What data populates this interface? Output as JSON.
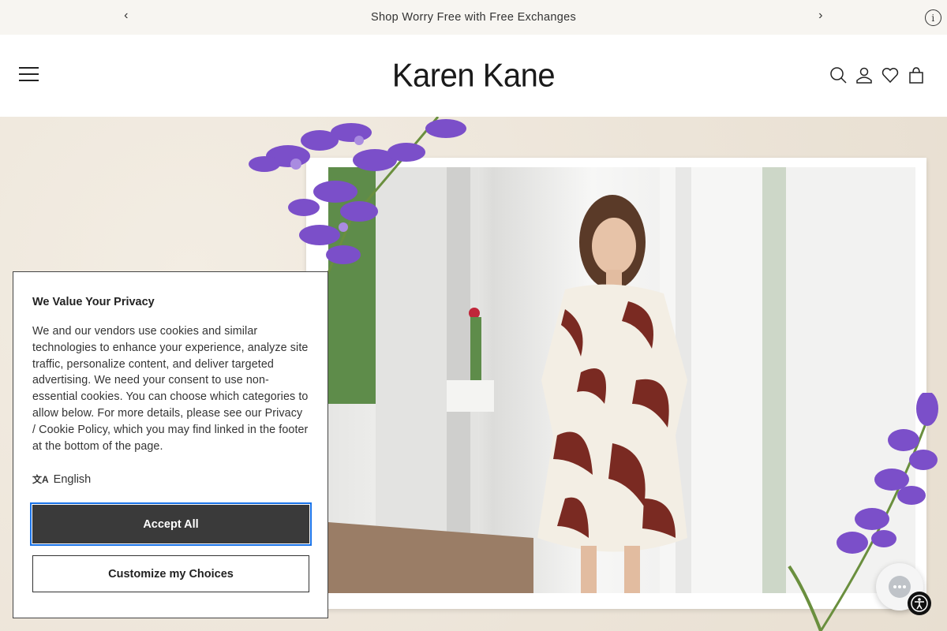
{
  "announcement": {
    "text": "Shop Worry Free with Free Exchanges",
    "prev_label": "‹",
    "next_label": "›",
    "info_label": "i"
  },
  "header": {
    "logo": "Karen Kane",
    "icons": [
      "search-icon",
      "account-icon",
      "wishlist-icon",
      "bag-icon"
    ]
  },
  "cookie_banner": {
    "title": "We Value Your Privacy",
    "body": "We and our vendors use cookies and similar technologies to enhance your experience, analyze site traffic, personalize content, and deliver targeted advertising. We need your consent to use non-essential cookies. You can choose which categories to allow below. For more details, please see our Privacy / Cookie Policy, which you may find linked in the footer at the bottom of the page.",
    "language_icon": "文A",
    "language": "English",
    "accept_label": "Accept All",
    "customize_label": "Customize my Choices"
  },
  "colors": {
    "accept_bg": "#3a3a3a",
    "focus_ring": "#1a73e8",
    "lavender": "#7b4fc9",
    "dress_print": "#7a2a22"
  }
}
